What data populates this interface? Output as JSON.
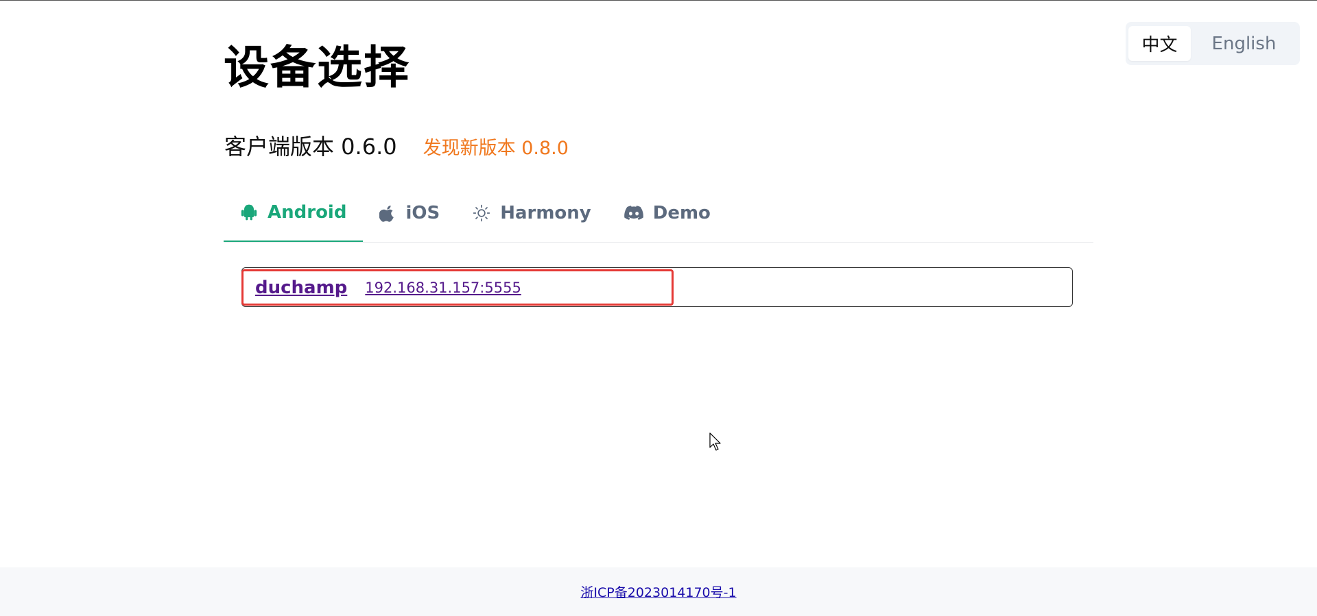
{
  "lang": {
    "zh": "中文",
    "en": "English"
  },
  "header": {
    "title": "设备选择",
    "client_version": "客户端版本 0.6.0",
    "new_version": "发现新版本 0.8.0"
  },
  "tabs": [
    {
      "label": "Android",
      "icon": "android-icon",
      "active": true
    },
    {
      "label": "iOS",
      "icon": "apple-icon",
      "active": false
    },
    {
      "label": "Harmony",
      "icon": "sun-icon",
      "active": false
    },
    {
      "label": "Demo",
      "icon": "discord-icon",
      "active": false
    }
  ],
  "devices": [
    {
      "name": "duchamp",
      "address": "192.168.31.157:5555"
    }
  ],
  "footer": {
    "icp": "浙ICP备2023014170号-1"
  },
  "colors": {
    "accent": "#1aa77a",
    "warning": "#f0781e",
    "highlight": "#e53935"
  }
}
